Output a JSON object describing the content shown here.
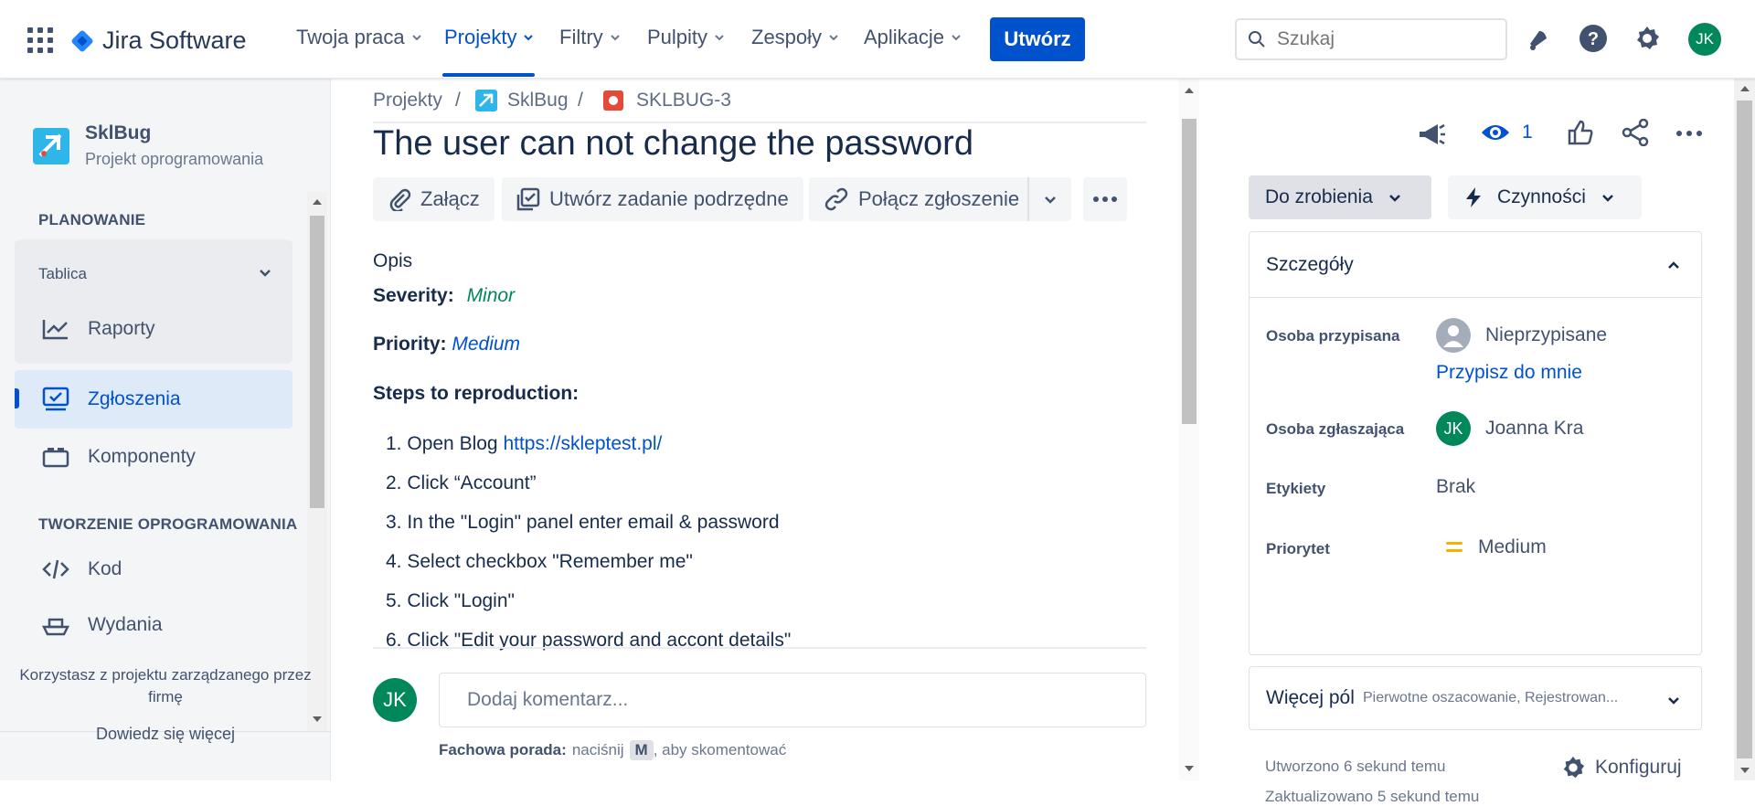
{
  "app": {
    "name": "Jira Software"
  },
  "nav": {
    "items": [
      "Twoja praca",
      "Projekty",
      "Filtry",
      "Pulpity",
      "Zespoły",
      "Aplikacje"
    ],
    "active": "Projekty",
    "create_label": "Utwórz",
    "search_placeholder": "Szukaj",
    "user_initials": "JK"
  },
  "sidebar": {
    "project_name": "SklBug",
    "project_type": "Projekt oprogramowania",
    "section_planning": "PLANOWANIE",
    "board_label": "Tablica",
    "reports_label": "Raporty",
    "issues_label": "Zgłoszenia",
    "components_label": "Komponenty",
    "section_dev": "TWORZENIE OPROGRAMOWANIA",
    "code_label": "Kod",
    "releases_label": "Wydania",
    "footer_text_line1": "Korzystasz z projektu zarządzanego przez",
    "footer_text_line2": "firmę",
    "learn_more": "Dowiedz się więcej"
  },
  "breadcrumb": {
    "projects": "Projekty",
    "project": "SklBug",
    "issue_key": "SKLBUG-3",
    "separator": "/"
  },
  "issue": {
    "title": "The user can not change the password",
    "toolbar": {
      "attach": "Załącz",
      "create_subtask": "Utwórz zadanie podrzędne",
      "link_issue": "Połącz zgłoszenie"
    },
    "description": {
      "heading": "Opis",
      "severity_label": "Severity:",
      "severity_value": "Minor",
      "priority_label": "Priority:",
      "priority_value": "Medium",
      "steps_heading": "Steps to reproduction:",
      "steps": [
        {
          "num": "1.",
          "text": "Open Blog ",
          "link": "https://skleptest.pl/"
        },
        {
          "num": "2.",
          "text": "Click “Account”"
        },
        {
          "num": "3.",
          "text": "In the \"Login\" panel enter email & password"
        },
        {
          "num": "4.",
          "text": "Select checkbox \"Remember me\""
        },
        {
          "num": "5.",
          "text": "Click \"Login\""
        },
        {
          "num": "6.",
          "text": "Click \"Edit your password and accont details\""
        }
      ]
    },
    "comment": {
      "placeholder": "Dodaj komentarz...",
      "tip_bold": "Fachowa porada:",
      "tip_pre": "naciśnij",
      "tip_key": "M",
      "tip_post": ", aby skomentować"
    }
  },
  "details": {
    "watchers_count": "1",
    "status_label": "Do zrobienia",
    "actions_label": "Czynności",
    "card_title": "Szczegóły",
    "assignee_label": "Osoba przypisana",
    "assignee_value": "Nieprzypisane",
    "assign_to_me": "Przypisz do mnie",
    "reporter_label": "Osoba zgłaszająca",
    "reporter_initials": "JK",
    "reporter_value": "Joanna Kra",
    "labels_label": "Etykiety",
    "labels_value": "Brak",
    "priority_label": "Priorytet",
    "priority_value": "Medium",
    "priority_color": "#ffab00",
    "more_fields_label": "Więcej pól",
    "more_fields_desc": "Pierwotne oszacowanie, Rejestrowan...",
    "created": "Utworzono 6 sekund temu",
    "updated": "Zaktualizowano 5 sekund temu",
    "configure": "Konfiguruj"
  },
  "colors": {
    "brand": "#0052cc",
    "avatar": "#00875a",
    "bug": "#e5493a"
  }
}
